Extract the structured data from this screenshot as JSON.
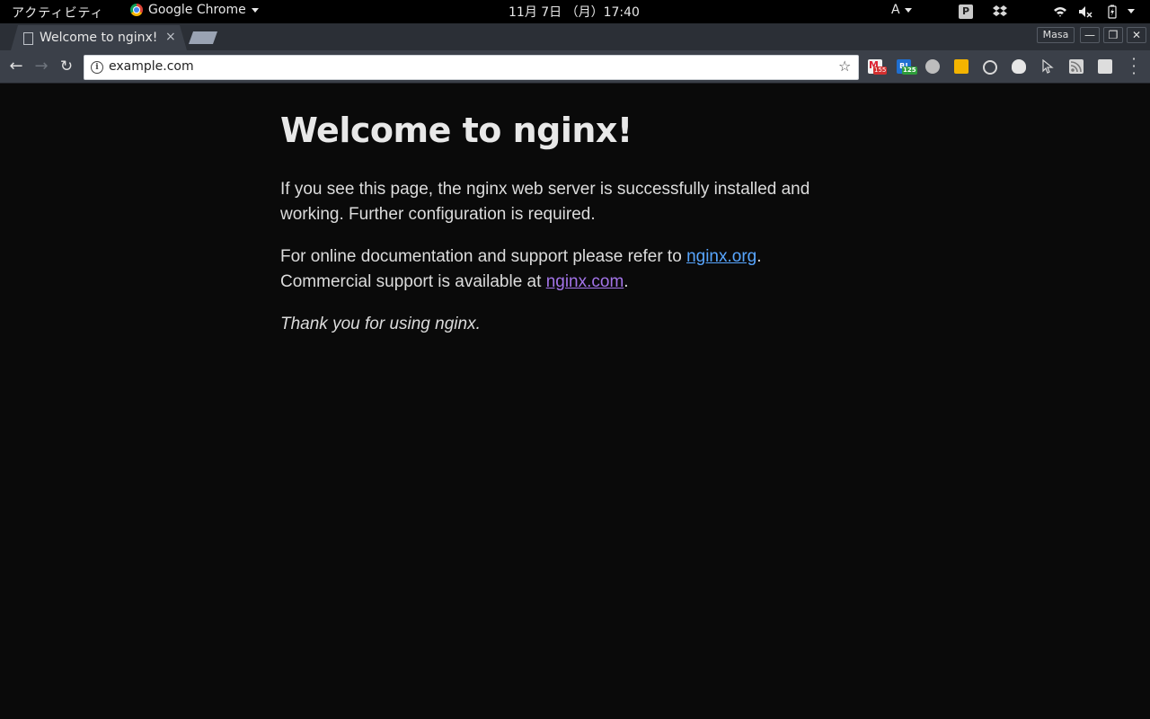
{
  "topbar": {
    "activities": "アクティビティ",
    "app_name": "Google Chrome",
    "clock": "11月  7日 （月）17:40",
    "ime": "A"
  },
  "tabs": [
    {
      "title": "Welcome to nginx!",
      "close": "×"
    }
  ],
  "window": {
    "profile": "Masa",
    "minimize": "—",
    "maximize": "❐",
    "close": "✕"
  },
  "toolbar": {
    "back": "←",
    "forward": "→",
    "reload": "↻",
    "url": "example.com",
    "star": "☆",
    "extensions": [
      {
        "name": "gmail-extension",
        "badge": "155"
      },
      {
        "name": "b-extension",
        "label": "B!",
        "badge": "125"
      },
      {
        "name": "pocket-extension"
      },
      {
        "name": "keep-extension"
      },
      {
        "name": "circle-extension"
      },
      {
        "name": "ghostery-extension"
      },
      {
        "name": "cursor-extension"
      },
      {
        "name": "rss-extension"
      },
      {
        "name": "grid-extension"
      }
    ]
  },
  "page": {
    "heading": "Welcome to nginx!",
    "para1": "If you see this page, the nginx web server is successfully installed and working. Further configuration is required.",
    "para2_before": "For online documentation and support please refer to ",
    "link_org": "nginx.org",
    "para2_mid": ".",
    "para2_line2": "Commercial support is available at ",
    "link_com": "nginx.com",
    "para2_end": ".",
    "para3": "Thank you for using nginx."
  },
  "colors": {
    "page_bg": "#0a0a0a",
    "link": "#58a6ff",
    "visited_link": "#a374e8",
    "toolbar_bg": "#3b4049"
  }
}
